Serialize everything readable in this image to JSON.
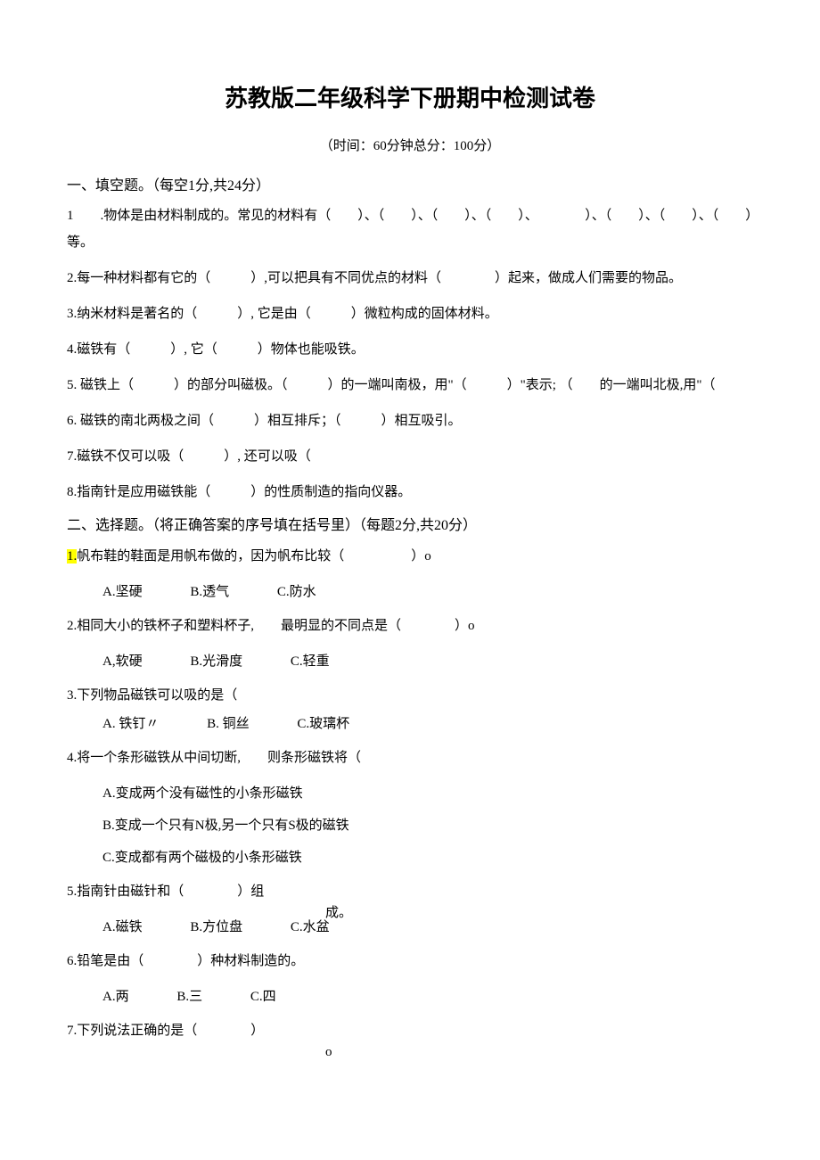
{
  "title": "苏教版二年级科学下册期中检测试卷",
  "subtitle": "（时间：60分钟总分：100分）",
  "section1": {
    "header": "一、填空题。（每空1分,共24分）",
    "q1": "1　　.物体是由材料制成的。常见的材料有（　　）、（　　）、（　　）、（　　）、　　　　）、（　　）、（　　）、（　　）等。",
    "q2": "2.每一种材料都有它的（　　　）,可以把具有不同优点的材料（　　　　）起来，做成人们需要的物品。",
    "q3": "3.纳米材料是著名的（　　　）, 它是由（　　　）微粒构成的固体材料。",
    "q4": "4.磁铁有（　　　）, 它（　　　）物体也能吸铁。",
    "q5": "5. 磁铁上（　　　）的部分叫磁极。（　　　）的一端叫南极，用\"（　　　）\"表示; （　　的一端叫北极,用\"（",
    "q6": "6. 磁铁的南北两极之间（　　　）相互排斥；（　　　）相互吸引。",
    "q7": "7.磁铁不仅可以吸（　　　）, 还可以吸（",
    "q8": "8.指南针是应用磁铁能（　　　）的性质制造的指向仪器。"
  },
  "section2": {
    "header": "二、选择题。（将正确答案的序号填在括号里）（每题2分,共20分）",
    "q1": {
      "num": "1.",
      "text": "帆布鞋的鞋面是用帆布做的，因为帆布比较（　　　　　）o",
      "optA": "A.坚硬",
      "optB": "B.透气",
      "optC": "C.防水"
    },
    "q2": {
      "text": "2.相同大小的铁杯子和塑料杯子,　　最明显的不同点是（　　　　）o",
      "optA": "A,软硬",
      "optB": "B.光滑度",
      "optC": "C.轻重"
    },
    "q3": {
      "text": "3.下列物品磁铁可以吸的是（",
      "optA": "A. 铁钉〃",
      "optB": "B. 铜丝",
      "optC": "C.玻璃杯"
    },
    "q4": {
      "text": "4.将一个条形磁铁从中间切断,　　则条形磁铁将（",
      "optA": "A.变成两个没有磁性的小条形磁铁",
      "optB": "B.变成一个只有N极,另一个只有S极的磁铁",
      "optC": "C.变成都有两个磁极的小条形磁铁"
    },
    "q5": {
      "text": "5.指南针由磁针和（　　　　）组",
      "cheng": "成。",
      "optA": "A.磁铁",
      "optB": "B.方位盘",
      "optC": "C.水盆"
    },
    "q6": {
      "text": "6.铅笔是由（　　　　）种材料制造的。",
      "optA": "A.两",
      "optB": "B.三",
      "optC": "C.四"
    },
    "q7": {
      "text": "7.下列说法正确的是（　　　　）",
      "o": "o"
    }
  }
}
